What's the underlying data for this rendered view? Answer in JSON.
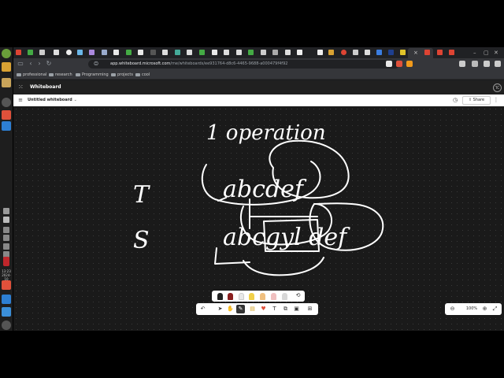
{
  "os": {
    "clock_time": "13:23",
    "clock_date": "2024-10"
  },
  "browser": {
    "url_host": "app.whiteboard.microsoft.com",
    "url_path": "/me/whiteboards/ee931764-d8c6-4465-9688-a000479f4f92",
    "bookmarks": [
      {
        "label": "professional"
      },
      {
        "label": "research"
      },
      {
        "label": "Programming"
      },
      {
        "label": "projects"
      },
      {
        "label": "cool"
      }
    ],
    "active_tab_close": "×"
  },
  "app": {
    "name": "Whiteboard",
    "avatar_initials": "TC",
    "doc_title": "Untitled whiteboard",
    "share_label": "Share",
    "zoom_level": "100%"
  },
  "ink": {
    "heading": "1 operation",
    "row_t_label": "T",
    "row_t_text": "abcdef",
    "row_s_label": "S",
    "row_s_text": "abcgyl def"
  },
  "icons": {
    "waffle": "waffle-icon",
    "back": "arrow-left-icon",
    "forward": "arrow-right-icon",
    "reload": "reload-icon",
    "history": "history-icon",
    "undo": "undo-icon",
    "zoom_in": "zoom-in-icon",
    "zoom_out": "zoom-out-icon",
    "fit": "fit-screen-icon"
  },
  "colors": {
    "canvas": "#1a1a1a",
    "ink": "#ffffff",
    "accent": "#ff5b3a"
  }
}
